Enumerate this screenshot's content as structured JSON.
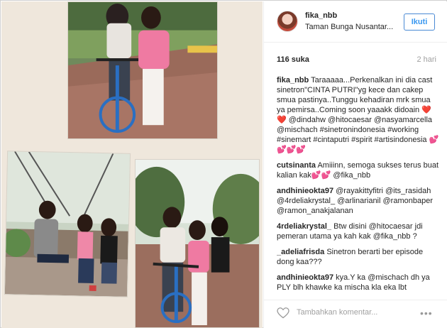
{
  "post": {
    "username": "fika_nbb",
    "location": "Taman Bunga Nusantar...",
    "follow_label": "Ikuti",
    "likes": "116 suka",
    "time_ago": "2 hari",
    "add_comment_placeholder": "Tambahkan komentar...",
    "more_label": "•••"
  },
  "comments": [
    {
      "user": "fika_nbb",
      "text": " Taraaaaa...Perkenalkan ini dia cast sinetron\"CINTA PUTRI\"yg kece dan cakep smua pastinya..Tunggu kehadiran mrk smua ya pemirsa..Coming soon yaaakk didoain ❤️❤️ ",
      "tail": "@dindahw @hitocaesar @nasyamarcella @mischach #sinetronindonesia #working #sinemart #cintaputri #spirit #artisindonesia 💕💕💕💕"
    },
    {
      "user": "cutsinanta",
      "text": " Amiiinn, semoga sukses terus buat kalian kak💕💕 ",
      "tail": "@fika_nbb"
    },
    {
      "user": "andhinieokta97",
      "text": " ",
      "tail": "@rayakittyfitri @its_rasidah @4rdeliakrystal_ @arlinarianil @ramonbaper @ramon_anakjalanan"
    },
    {
      "user": "4rdeliakrystal_",
      "text": " Btw disini ",
      "tail": "@hitocaesar",
      "text2": " jdi pemeran utama ya kah kak ",
      "tail2": "@fika_nbb",
      "text3": " ?"
    },
    {
      "user": "_adeliafrisda",
      "text": " Sinetron berarti ber episode dong kaa???"
    },
    {
      "user": "andhinieokta97",
      "text": " kya.Y ka ",
      "tail": "@mischach",
      "text2": " dh ya PLY blh khawke ka mischa kla eka lbt"
    }
  ]
}
